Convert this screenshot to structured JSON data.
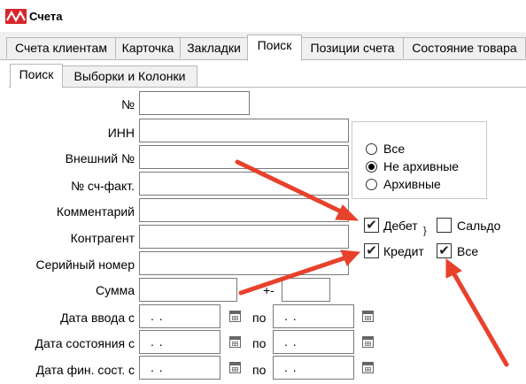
{
  "window": {
    "title": "Счета"
  },
  "tabs": [
    {
      "label": "Счета клиентам"
    },
    {
      "label": "Карточка"
    },
    {
      "label": "Закладки"
    },
    {
      "label": "Поиск"
    },
    {
      "label": "Позиции счета"
    },
    {
      "label": "Состояние товара"
    }
  ],
  "subtabs": [
    {
      "label": "Поиск"
    },
    {
      "label": "Выборки и Колонки"
    }
  ],
  "form": {
    "number_label": "№",
    "inn_label": "ИНН",
    "external_label": "Внешний №",
    "invoice_label": "№ сч-факт.",
    "comment_label": "Комментарий",
    "counterparty_label": "Контрагент",
    "serial_label": "Серийный номер",
    "sum_label": "Сумма",
    "sum_sep": "+-",
    "date_entry_label": "Дата ввода с",
    "date_state_label": "Дата состояния с",
    "date_fin_label": "Дата фин. сост. с",
    "to_label": "по",
    "date_placeholder": ". ."
  },
  "archive": {
    "options": [
      {
        "label": "Все",
        "selected": false
      },
      {
        "label": "Не архивные",
        "selected": true
      },
      {
        "label": "Архивные",
        "selected": false
      }
    ]
  },
  "checks": {
    "debit": {
      "label": "Дебет",
      "checked": true
    },
    "saldo": {
      "label": "Сальдо",
      "checked": false
    },
    "credit": {
      "label": "Кредит",
      "checked": true
    },
    "all": {
      "label": "Все",
      "checked": true
    },
    "brace": "}",
    "check_mark": "✔"
  },
  "colors": {
    "annotation_arrow": "#e8412c",
    "logo": "#d7262b"
  }
}
